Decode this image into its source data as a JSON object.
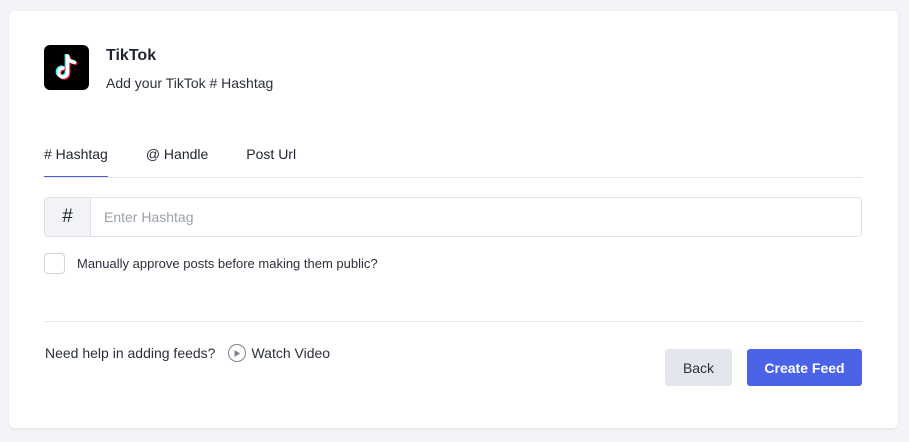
{
  "header": {
    "title": "TikTok",
    "subtitle": "Add your TikTok # Hashtag",
    "logo_icon": "tiktok-logo"
  },
  "tabs": [
    {
      "label": "# Hashtag",
      "active": true
    },
    {
      "label": "@ Handle",
      "active": false
    },
    {
      "label": "Post Url",
      "active": false
    }
  ],
  "hashtag_input": {
    "prefix": "#",
    "value": "",
    "placeholder": "Enter Hashtag"
  },
  "approve": {
    "label": "Manually approve posts before making them public?",
    "checked": false
  },
  "help": {
    "text": "Need help in adding feeds?",
    "watch_label": "Watch Video",
    "watch_icon": "play-circle-icon"
  },
  "buttons": {
    "back_label": "Back",
    "create_label": "Create Feed"
  },
  "colors": {
    "accent": "#4b63e6",
    "tab_underline": "#4a5fd9",
    "back_button_bg": "#e4e6ee",
    "logo_bg": "#000000"
  }
}
